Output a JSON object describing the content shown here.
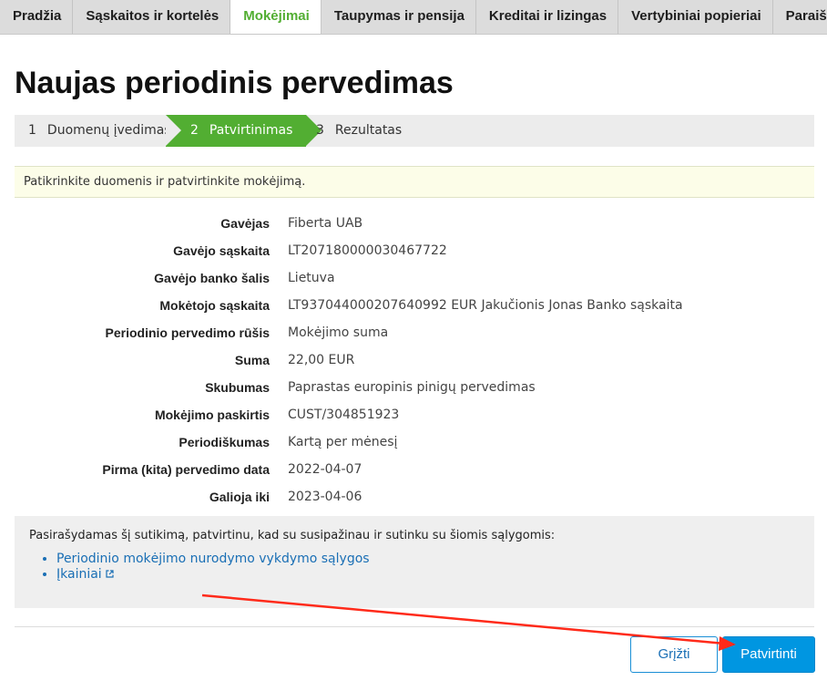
{
  "nav": {
    "items": [
      {
        "label": "Pradžia",
        "active": false
      },
      {
        "label": "Sąskaitos ir kortelės",
        "active": false
      },
      {
        "label": "Mokėjimai",
        "active": true
      },
      {
        "label": "Taupymas ir pensija",
        "active": false
      },
      {
        "label": "Kreditai ir lizingas",
        "active": false
      },
      {
        "label": "Vertybiniai popieriai",
        "active": false
      },
      {
        "label": "Paraiškos",
        "active": false
      }
    ]
  },
  "page": {
    "title": "Naujas periodinis pervedimas"
  },
  "stepper": {
    "steps": [
      {
        "num": "1",
        "label": "Duomenų įvedimas"
      },
      {
        "num": "2",
        "label": "Patvirtinimas"
      },
      {
        "num": "3",
        "label": "Rezultatas"
      }
    ]
  },
  "info": {
    "text": "Patikrinkite duomenis ir patvirtinkite mokėjimą."
  },
  "details": [
    {
      "label": "Gavėjas",
      "value": "Fiberta UAB"
    },
    {
      "label": "Gavėjo sąskaita",
      "value": "LT207180000030467722"
    },
    {
      "label": "Gavėjo banko šalis",
      "value": "Lietuva"
    },
    {
      "label": "Mokėtojo sąskaita",
      "value": "LT937044000207640992 EUR Jakučionis Jonas Banko sąskaita"
    },
    {
      "label": "Periodinio pervedimo rūšis",
      "value": "Mokėjimo suma"
    },
    {
      "label": "Suma",
      "value": "22,00 EUR"
    },
    {
      "label": "Skubumas",
      "value": "Paprastas europinis pinigų pervedimas"
    },
    {
      "label": "Mokėjimo paskirtis",
      "value": "CUST/304851923"
    },
    {
      "label": "Periodiškumas",
      "value": "Kartą per mėnesį"
    },
    {
      "label": "Pirma (kita) pervedimo data",
      "value": "2022-04-07"
    },
    {
      "label": "Galioja iki",
      "value": "2023-04-06"
    }
  ],
  "agreement": {
    "text": "Pasirašydamas šį sutikimą, patvirtinu, kad su susipažinau ir sutinku su šiomis sąlygomis:",
    "links": [
      {
        "label": "Periodinio mokėjimo nurodymo vykdymo sąlygos",
        "icon": ""
      },
      {
        "label": "Įkainiai",
        "icon": "external-link-icon"
      }
    ]
  },
  "buttons": {
    "back": "Grįžti",
    "confirm": "Patvirtinti"
  },
  "colors": {
    "accent_green": "#52ae32",
    "primary_blue": "#0096e1",
    "link_blue": "#1a6fb5",
    "annotation_red": "#ff2a1a"
  }
}
